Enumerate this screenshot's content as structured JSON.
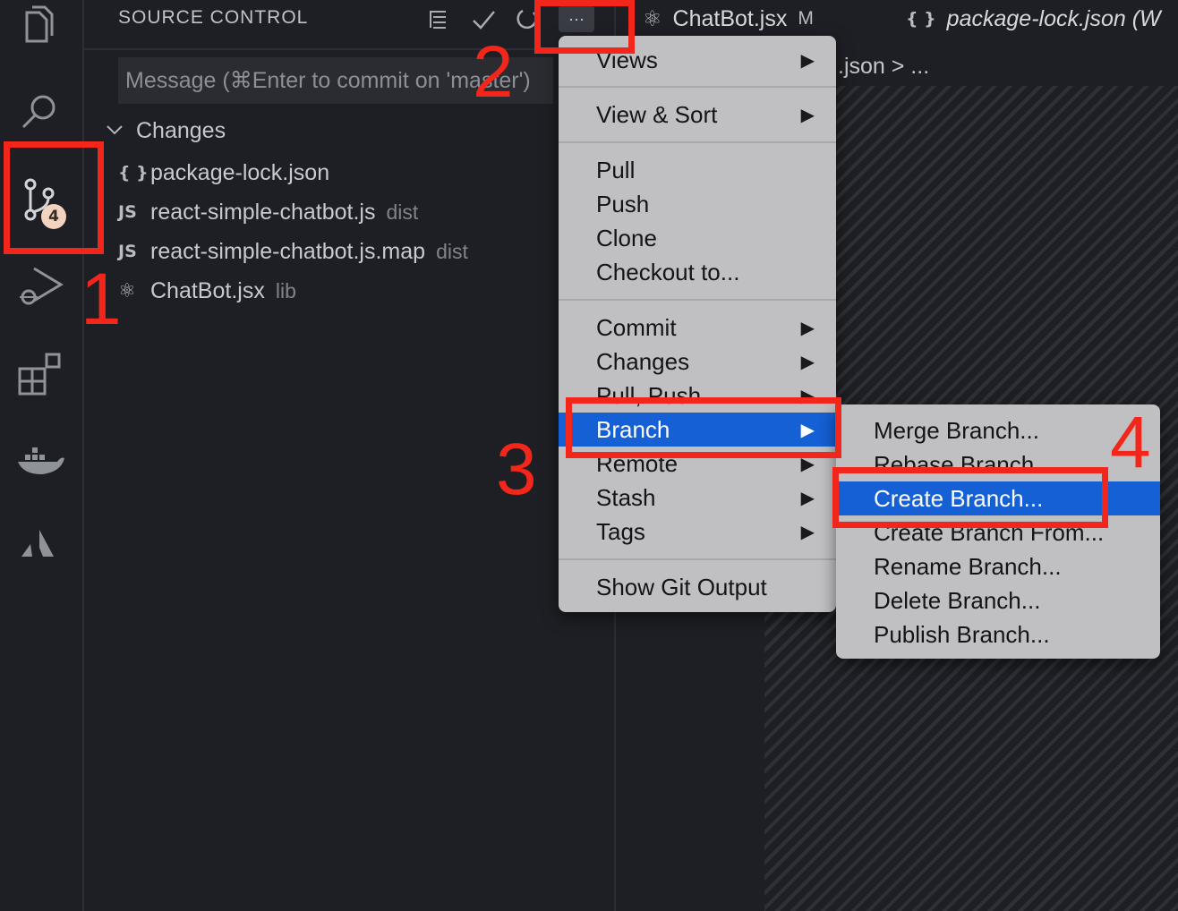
{
  "activity_bar": {
    "icons": [
      "files-icon",
      "search-icon",
      "source-control-icon",
      "run-debug-icon",
      "extensions-icon",
      "docker-icon",
      "atlassian-icon"
    ],
    "source_control_badge": "4"
  },
  "sidebar": {
    "title": "SOURCE CONTROL",
    "toolbar": [
      "view-as-tree-icon",
      "commit-check-icon",
      "refresh-icon",
      "more-actions-icon"
    ],
    "more_actions_label": "···",
    "commit_placeholder": "Message (⌘Enter to commit on 'master')",
    "changes_label": "Changes",
    "files": [
      {
        "icon": "{ }",
        "name": "package-lock.json",
        "desc": ""
      },
      {
        "icon": "JS",
        "name": "react-simple-chatbot.js",
        "desc": "dist"
      },
      {
        "icon": "JS",
        "name": "react-simple-chatbot.js.map",
        "desc": "dist"
      },
      {
        "icon": "⚛",
        "name": "ChatBot.jsx",
        "desc": "lib"
      }
    ]
  },
  "editor": {
    "tabs": [
      {
        "icon": "⚛",
        "label": "ChatBot.jsx",
        "status": "M"
      },
      {
        "icon": "{ }",
        "label": "package-lock.json (W"
      }
    ],
    "breadcrumb": ".json > ..."
  },
  "menu": {
    "items": [
      "Views",
      "View & Sort",
      "Pull",
      "Push",
      "Clone",
      "Checkout to...",
      "Commit",
      "Changes",
      "Pull, Push",
      "Branch",
      "Remote",
      "Stash",
      "Tags",
      "Show Git Output"
    ],
    "arrow": "▶"
  },
  "submenu": {
    "items": [
      "Merge Branch...",
      "Rebase Branch...",
      "Create Branch...",
      "Create Branch From...",
      "Rename Branch...",
      "Delete Branch...",
      "Publish Branch..."
    ]
  },
  "annotations": [
    "1",
    "2",
    "3",
    "4"
  ],
  "colors": {
    "background": "#1e1f24",
    "menu_background": "#c0c0c3",
    "menu_highlight": "#1560d4",
    "annotation_red": "#f2261a"
  }
}
